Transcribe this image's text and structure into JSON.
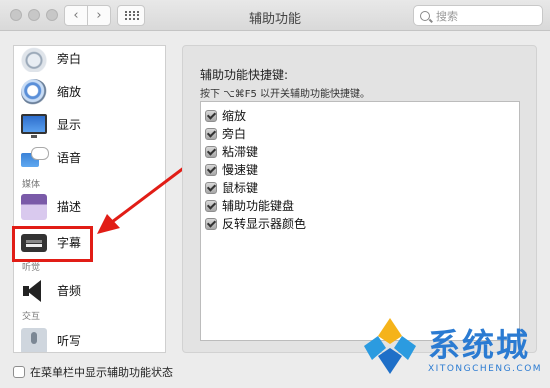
{
  "window": {
    "title": "辅助功能",
    "search_placeholder": "搜索"
  },
  "sidebar": {
    "items": [
      {
        "label": "旁白",
        "icon": "narrator-icon"
      },
      {
        "label": "缩放",
        "icon": "zoom-icon"
      },
      {
        "label": "显示",
        "icon": "display-icon"
      },
      {
        "label": "语音",
        "icon": "speech-icon"
      },
      {
        "label": "描述",
        "icon": "descriptions-icon"
      },
      {
        "label": "字幕",
        "icon": "captions-icon"
      },
      {
        "label": "音频",
        "icon": "audio-icon"
      },
      {
        "label": "听写",
        "icon": "dictation-icon"
      }
    ],
    "categories": [
      "媒体",
      "听觉",
      "交互"
    ],
    "highlighted_item": "字幕"
  },
  "panel": {
    "heading": "辅助功能快捷键:",
    "description": "按下 ⌥⌘F5 以开关辅助功能快捷键。",
    "shortcuts": [
      {
        "label": "缩放",
        "checked": true
      },
      {
        "label": "旁白",
        "checked": true
      },
      {
        "label": "粘滞键",
        "checked": true
      },
      {
        "label": "慢速键",
        "checked": true
      },
      {
        "label": "鼠标键",
        "checked": true
      },
      {
        "label": "辅助功能键盘",
        "checked": true
      },
      {
        "label": "反转显示器颜色",
        "checked": true
      }
    ]
  },
  "footer": {
    "show_in_menubar_label": "在菜单栏中显示辅助功能状态",
    "show_in_menubar_checked": false
  },
  "watermark": {
    "text": "系统城",
    "subtext": "XITONGCHENG.COM"
  },
  "colors": {
    "highlight": "#e11d16",
    "watermark": "#2b7bd2"
  }
}
